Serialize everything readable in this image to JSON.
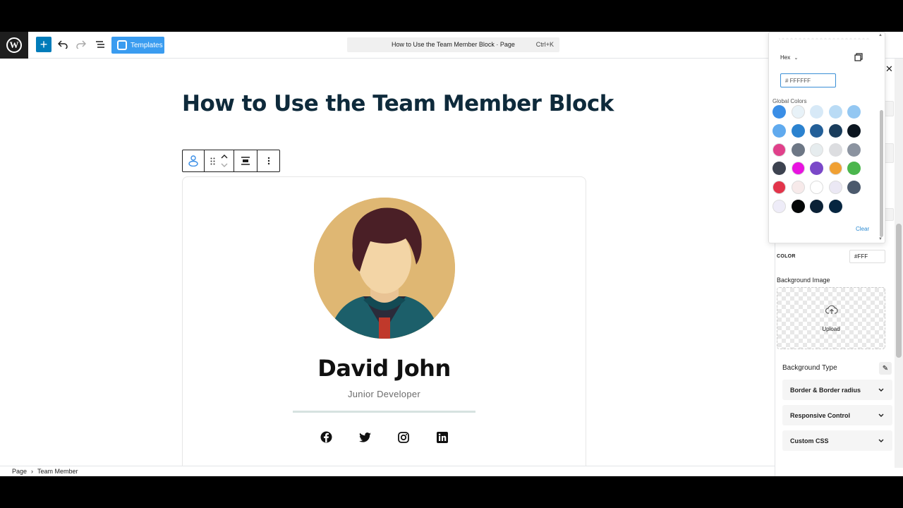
{
  "toolbar": {
    "templates_label": "Templates",
    "document_title": "How to Use the Team Member Block · Page",
    "shortcut": "Ctrl+K"
  },
  "post": {
    "title": "How to Use the Team Member Block"
  },
  "team_member": {
    "name": "David John",
    "role": "Junior Developer",
    "socials": [
      "facebook-icon",
      "twitter-icon",
      "instagram-icon",
      "linkedin-icon"
    ]
  },
  "breadcrumb": {
    "items": [
      "Page",
      "Team Member"
    ]
  },
  "color_picker": {
    "mode": "Hex",
    "hex_value": "# FFFFFF",
    "global_colors_label": "Global Colors",
    "clear_label": "Clear",
    "swatches": [
      [
        "#3a8ee6",
        "#e8f2f8",
        "#d7e9f7",
        "#b9dbf5",
        "#93c7f2"
      ],
      [
        "#60aaee",
        "#2b82cf",
        "#235f98",
        "#1a3d5c",
        "#0b1520"
      ],
      [
        "#e0408a",
        "#6d7785",
        "#e6ecee",
        "#dcdde0",
        "#8b93a0"
      ],
      [
        "#3d4350",
        "#e813e0",
        "#7a48c8",
        "#f0a033",
        "#4bb64d"
      ],
      [
        "#e2344a",
        "#f7eaea",
        "#ffffff",
        "#ebe8f4",
        "#4c5a6d"
      ],
      [
        "#eeecf8",
        "#050708",
        "#0b2136",
        "#062540"
      ]
    ]
  },
  "sidebar": {
    "color_label": "COLOR",
    "color_value": "#FFF",
    "background_image_label": "Background Image",
    "upload_label": "Upload",
    "background_type_label": "Background Type",
    "panels": [
      "Border & Border radius",
      "Responsive Control",
      "Custom CSS"
    ]
  }
}
